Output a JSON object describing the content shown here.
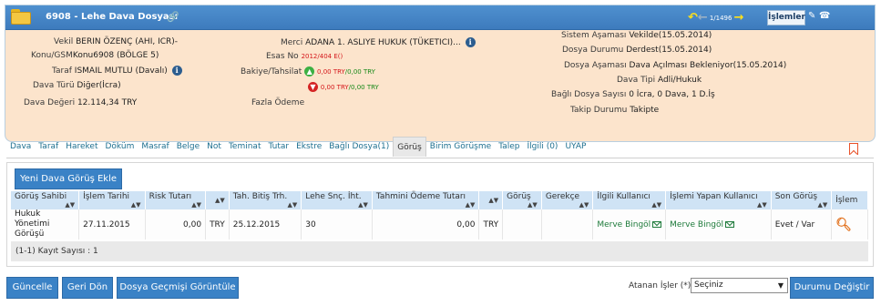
{
  "header": {
    "title": "6908 - Lehe Dava Dosyası",
    "counter": "1/1496",
    "islemler_label": "İşlemler"
  },
  "case": {
    "vekil_label": "Vekil",
    "vekil_value": "BERIN ÖZENÇ (AHI, ICR)-",
    "konu_label": "Konu/GSM",
    "konu_value": "Konu6908 (BÖLGE 5)",
    "taraf_label": "Taraf",
    "taraf_value": "ISMAIL MUTLU (Davalı)",
    "dava_turu_label": "Dava Türü",
    "dava_turu_value": "Diğer(İcra)",
    "dava_degeri_label": "Dava Değeri",
    "dava_degeri_value": "12.114,34 TRY",
    "merci_label": "Merci",
    "merci_value": "ADANA 1. ASLIYE HUKUK (TÜKETICI)...",
    "esas_label": "Esas No",
    "esas_value": "2012/404 E()",
    "bakiye_label": "Bakiye/Tahsilat",
    "bakiye_up": "0,00 TRY",
    "bakiye_up2": "0,00 TRY",
    "bakiye_down": "0,00 TRY",
    "bakiye_down2": "0,00 TRY",
    "fazla_label": "Fazla Ödeme",
    "sistem_label": "Sistem Aşaması",
    "sistem_value": "Vekilde(15.05.2014)",
    "durum_label": "Dosya Durumu",
    "durum_value": "Derdest(15.05.2014)",
    "asama_label": "Dosya Aşaması",
    "asama_value": "Dava Açılması Bekleniyor(15.05.2014)",
    "tip_label": "Dava Tipi",
    "tip_value": "Adli/Hukuk",
    "bagli_label": "Bağlı Dosya Sayısı",
    "bagli_value": "0 İcra, 0 Dava, 1 D.İş",
    "takip_label": "Takip Durumu",
    "takip_value": "Takipte"
  },
  "tabs": [
    "Dava",
    "Taraf",
    "Hareket",
    "Döküm",
    "Masraf",
    "Belge",
    "Not",
    "Teminat",
    "Tutar",
    "Ekstre",
    "Bağlı Dosya(1)",
    "Görüş",
    "Birim Görüşme",
    "Talep",
    "İlgili (0)",
    "UYAP"
  ],
  "grid": {
    "add_button": "Yeni Dava Görüş Ekle",
    "columns": [
      "Görüş Sahibi",
      "İşlem Tarihi",
      "Risk Tutarı",
      "",
      "Tah. Bitiş Trh.",
      "Lehe Snç. İht.",
      "Tahmini Ödeme Tutarı",
      "",
      "Görüş",
      "Gerekçe",
      "İlgili Kullanıcı",
      "İşlemi Yapan Kullanıcı",
      "Son Görüş",
      "İşlem"
    ],
    "rows": [
      [
        "Hukuk Yönetimi Görüşü",
        "27.11.2015",
        "0,00",
        "TRY",
        "25.12.2015",
        "30",
        "0,00",
        "TRY",
        "",
        "",
        "Merve Bingöl",
        "Merve Bingöl",
        "Evet / Var",
        ""
      ]
    ],
    "record_count": "(1-1) Kayıt Sayısı : 1"
  },
  "bottom": {
    "guncelle": "Güncelle",
    "geri_don": "Geri Dön",
    "gecmis": "Dosya Geçmişi Görüntüle",
    "atanan_label": "Atanan İşler (*)",
    "select_value": "Seçiniz",
    "degistir": "Durumu Değiştir"
  },
  "colors": {
    "accent": "#3a82c6",
    "panel_bg": "#fce4cc",
    "header_bg": "#4f90cf",
    "search_icon": "#e27320"
  }
}
